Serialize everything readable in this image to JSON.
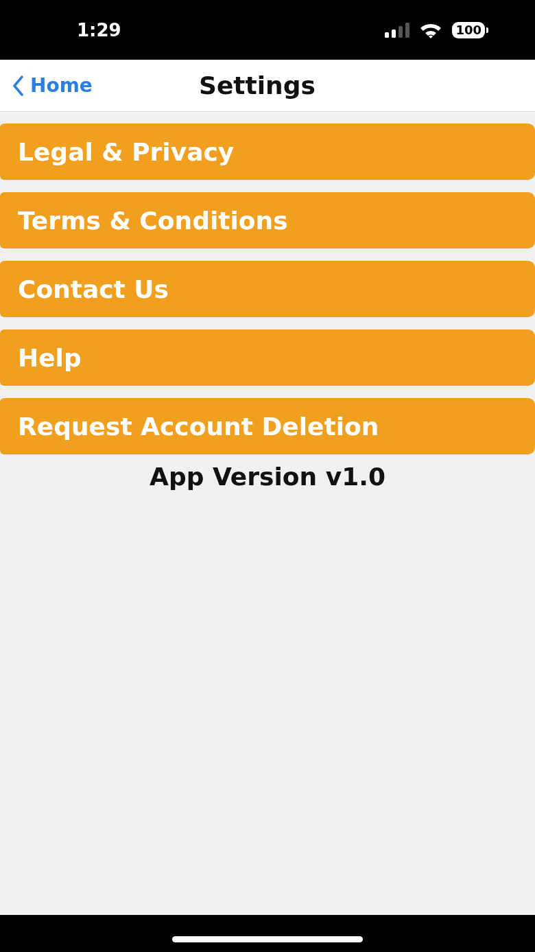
{
  "status_bar": {
    "time": "1:29",
    "battery": "100"
  },
  "nav": {
    "back": "Home",
    "title": "Settings"
  },
  "menu": [
    {
      "label": "Legal & Privacy"
    },
    {
      "label": "Terms & Conditions"
    },
    {
      "label": "Contact Us"
    },
    {
      "label": "Help"
    },
    {
      "label": "Request Account Deletion"
    }
  ],
  "version": "App Version v1.0"
}
